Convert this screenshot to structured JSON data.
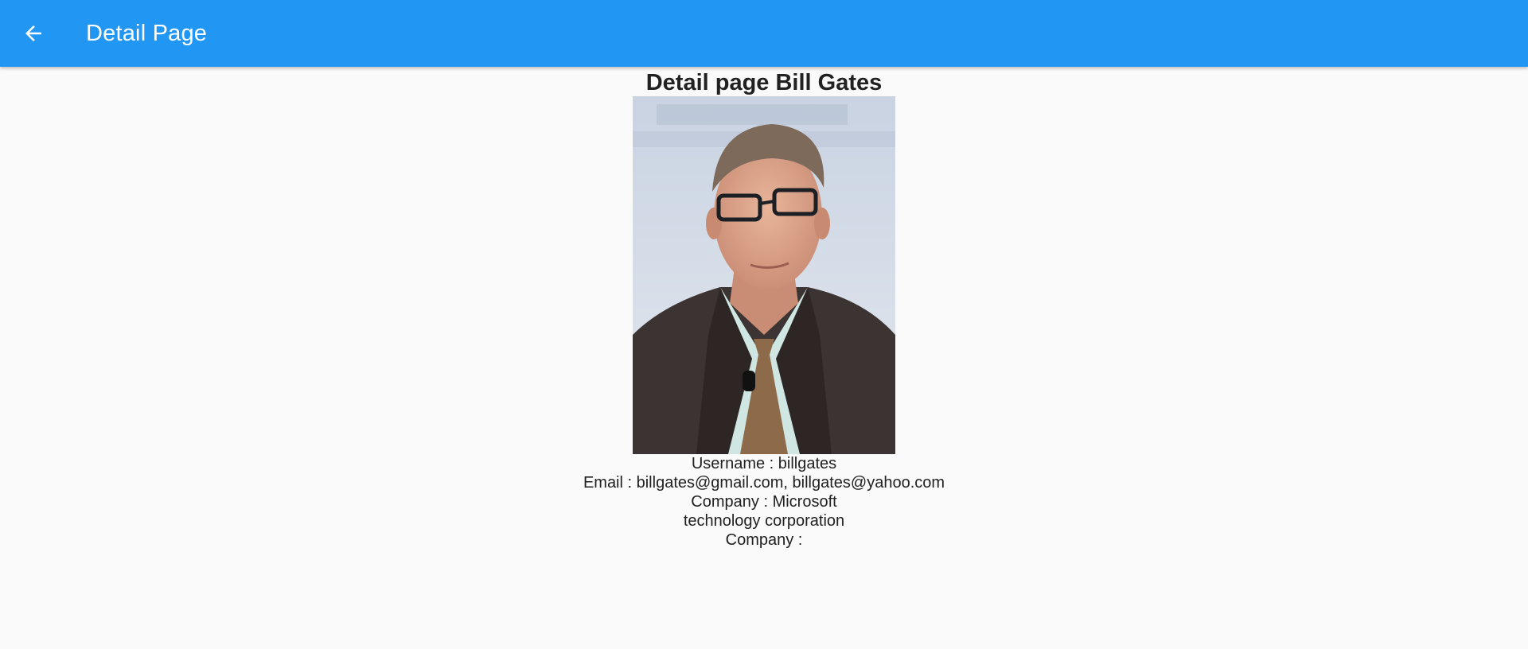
{
  "app_bar": {
    "title": "Detail Page",
    "back_icon": "arrow-back-icon",
    "color": "#2196f3"
  },
  "detail": {
    "heading": "Detail page Bill Gates",
    "photo_description": "portrait-photo",
    "username_line": "Username : billgates",
    "email_line": "Email : billgates@gmail.com, billgates@yahoo.com",
    "company_line_1": "Company : Microsoft",
    "company_line_2": "technology corporation",
    "company_line_3": "Company :"
  },
  "colors": {
    "background": "#fafafa",
    "text": "#212121"
  }
}
